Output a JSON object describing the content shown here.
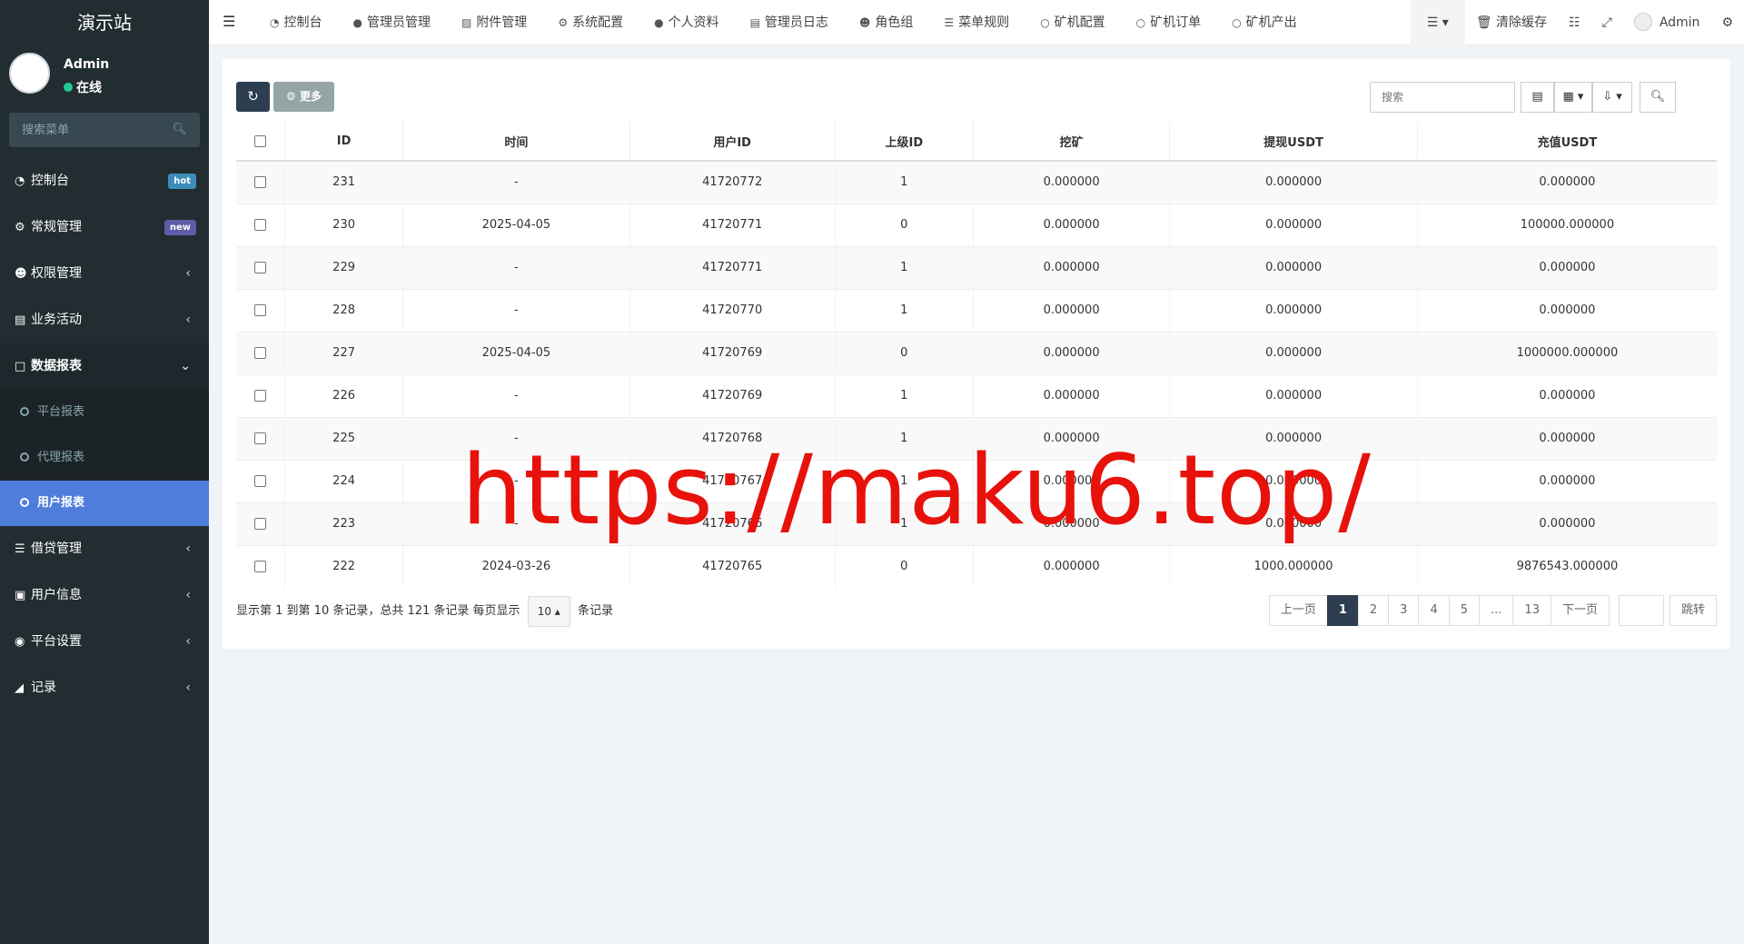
{
  "sidebar": {
    "brand": "演示站",
    "user": {
      "name": "Admin",
      "status": "在线"
    },
    "search_placeholder": "搜索菜单",
    "items": [
      {
        "label": "控制台",
        "icon": "dashboard-icon",
        "badge": "hot",
        "badge_color": "#3c8dbc"
      },
      {
        "label": "常规管理",
        "icon": "cogs-icon",
        "badge": "new",
        "badge_color": "#605ca8"
      },
      {
        "label": "权限管理",
        "icon": "users-icon"
      },
      {
        "label": "业务活动",
        "icon": "rectangle-list-icon"
      },
      {
        "label": "数据报表",
        "icon": "file-icon",
        "open": true
      }
    ],
    "sub_items": [
      {
        "label": "平台报表"
      },
      {
        "label": "代理报表"
      },
      {
        "label": "用户报表",
        "active": true
      }
    ],
    "items_after": [
      {
        "label": "借贷管理",
        "icon": "list-icon"
      },
      {
        "label": "用户信息",
        "icon": "address-book-icon"
      },
      {
        "label": "平台设置",
        "icon": "dot-circle-icon"
      },
      {
        "label": "记录",
        "icon": "area-chart-icon"
      }
    ]
  },
  "topnav": [
    {
      "label": "控制台",
      "icon": "dashboard-icon"
    },
    {
      "label": "管理员管理",
      "icon": "user-icon"
    },
    {
      "label": "附件管理",
      "icon": "file-image-icon"
    },
    {
      "label": "系统配置",
      "icon": "cog-icon"
    },
    {
      "label": "个人资料",
      "icon": "user-icon"
    },
    {
      "label": "管理员日志",
      "icon": "list-alt-icon"
    },
    {
      "label": "角色组",
      "icon": "group-icon"
    },
    {
      "label": "菜单规则",
      "icon": "bars-icon"
    },
    {
      "label": "矿机配置",
      "icon": "circle-icon"
    },
    {
      "label": "矿机订单",
      "icon": "circle-icon"
    },
    {
      "label": "矿机产出",
      "icon": "circle-icon"
    }
  ],
  "topright": {
    "clear_cache": "清除缓存",
    "admin": "Admin"
  },
  "toolbar": {
    "more_label": "更多",
    "search_placeholder": "搜索"
  },
  "table": {
    "columns": [
      "ID",
      "时间",
      "用户ID",
      "上级ID",
      "挖矿",
      "提现USDT",
      "充值USDT"
    ],
    "rows": [
      [
        "231",
        "-",
        "41720772",
        "1",
        "0.000000",
        "0.000000",
        "0.000000"
      ],
      [
        "230",
        "2025-04-05",
        "41720771",
        "0",
        "0.000000",
        "0.000000",
        "100000.000000"
      ],
      [
        "229",
        "-",
        "41720771",
        "1",
        "0.000000",
        "0.000000",
        "0.000000"
      ],
      [
        "228",
        "-",
        "41720770",
        "1",
        "0.000000",
        "0.000000",
        "0.000000"
      ],
      [
        "227",
        "2025-04-05",
        "41720769",
        "0",
        "0.000000",
        "0.000000",
        "1000000.000000"
      ],
      [
        "226",
        "-",
        "41720769",
        "1",
        "0.000000",
        "0.000000",
        "0.000000"
      ],
      [
        "225",
        "-",
        "41720768",
        "1",
        "0.000000",
        "0.000000",
        "0.000000"
      ],
      [
        "224",
        "-",
        "41720767",
        "1",
        "0.000000",
        "0.000000",
        "0.000000"
      ],
      [
        "223",
        "-",
        "41720766",
        "1",
        "0.000000",
        "0.000000",
        "0.000000"
      ],
      [
        "222",
        "2024-03-26",
        "41720765",
        "0",
        "0.000000",
        "1000.000000",
        "9876543.000000"
      ]
    ]
  },
  "pagination": {
    "info": "显示第 1 到第 10 条记录，总共 121 条记录 每页显示",
    "page_size": "10",
    "suffix": "条记录",
    "prev": "上一页",
    "pages": [
      "1",
      "2",
      "3",
      "4",
      "5",
      "...",
      "13"
    ],
    "next": "下一页",
    "jump": "跳转"
  },
  "watermark": "https://maku6.top/"
}
